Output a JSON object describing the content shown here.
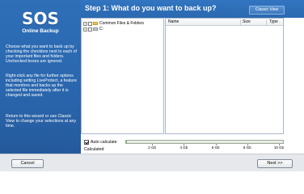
{
  "logo": {
    "mark": "SOS",
    "subtitle": "Online Backup"
  },
  "sidebar": {
    "paragraphs": [
      "Choose what you want to back up by checking the checkbox next to each of your important files and folders. Unchecked boxes are ignored.",
      "Right-click any file for further options including setting LiveProtect, a feature that monitors and backs up the selected file immediately after it is changed and saved.",
      "Return to this wizard or use Classic View to change your selections at any time."
    ]
  },
  "header": {
    "title": "Step 1: What do you want to back up?",
    "classic_view_label": "Classic View"
  },
  "tree": {
    "items": [
      {
        "label": "Common Files & Folders",
        "icon": "folder-icon",
        "expander": "+"
      },
      {
        "label": "C:",
        "icon": "drive-icon",
        "expander": "+"
      }
    ]
  },
  "filelist": {
    "columns": [
      "Name",
      "Size",
      "Type"
    ]
  },
  "calc": {
    "auto_label": "Auto calculate",
    "auto_checked": true,
    "calculated_label": "Calculated",
    "scale_labels": [
      "2 Gb",
      "4 Gb",
      "6 Gb",
      "8 Gb",
      "10 Gb"
    ],
    "scale_max_gb": 10,
    "calculated_gb": 0
  },
  "footer": {
    "cancel_label": "Cancel",
    "next_label": "Next >>"
  },
  "colors": {
    "brand_blue": "#2e6fb8",
    "header_blue": "#3275c0"
  }
}
